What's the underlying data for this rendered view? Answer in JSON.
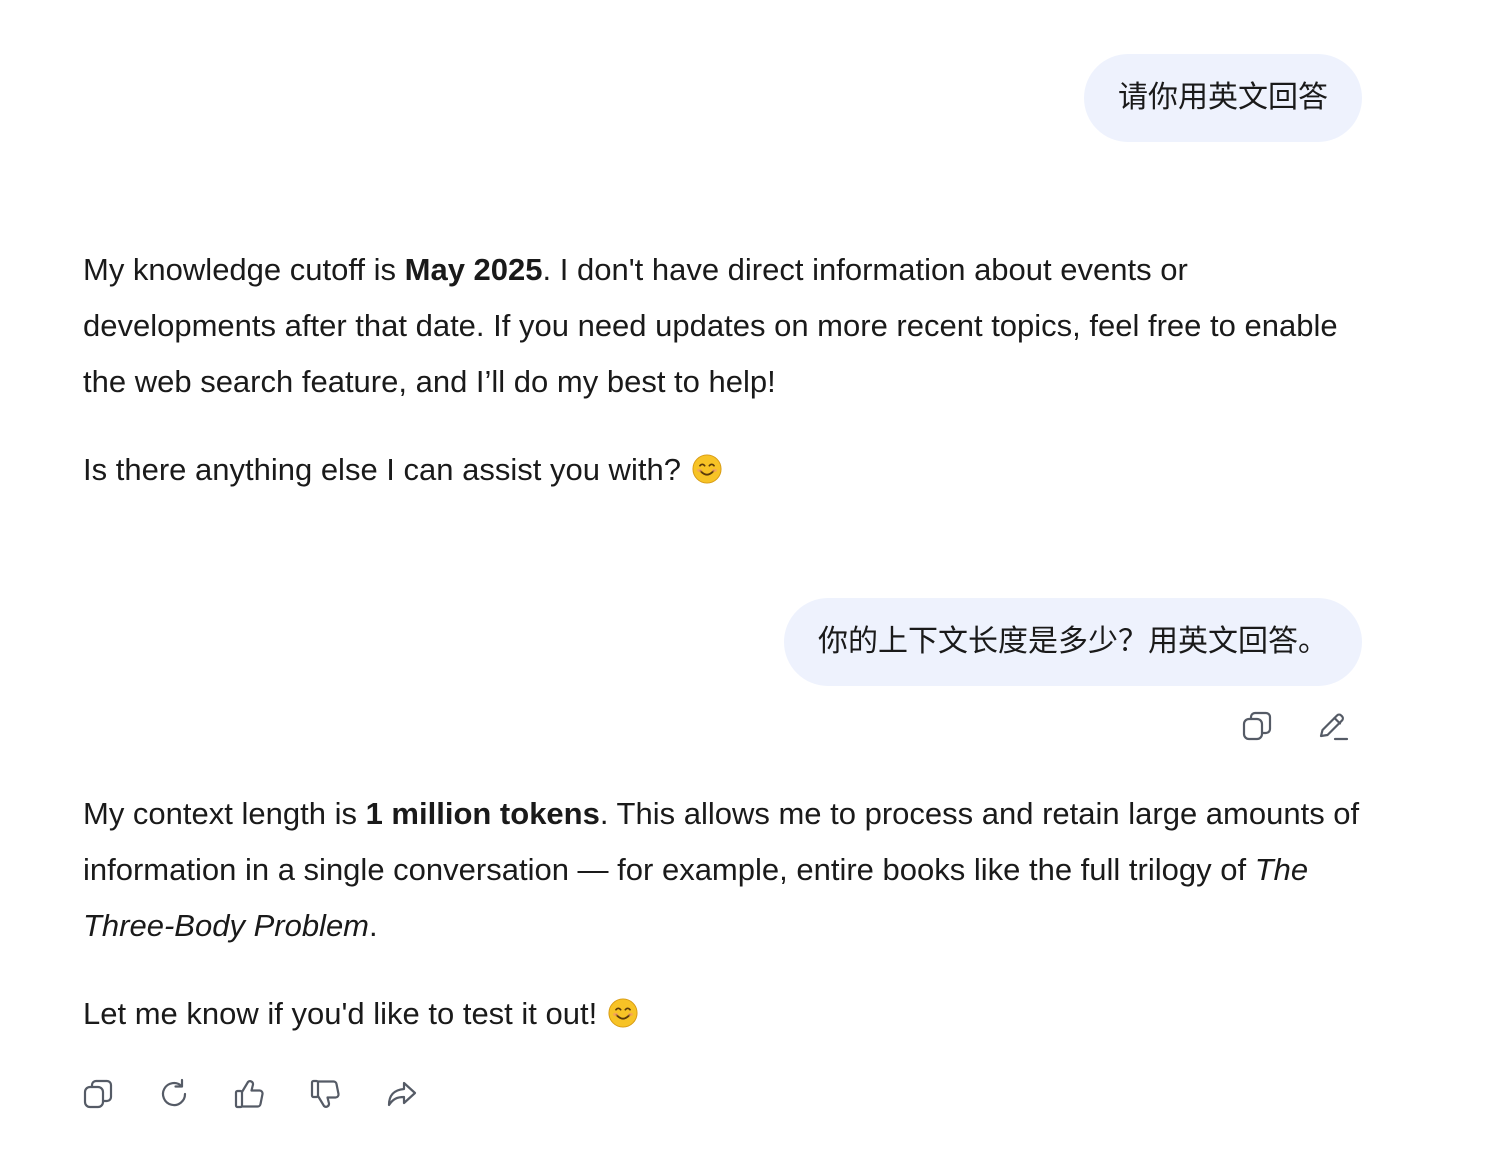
{
  "conversation": {
    "user_messages": [
      {
        "text": "请你用英文回答"
      },
      {
        "text": "你的上下文长度是多少？用英文回答。"
      }
    ],
    "answers": [
      {
        "p1_before": "My knowledge cutoff is ",
        "p1_bold": "May 2025",
        "p1_after": ". I don't have direct information about events or developments after that date. If you need updates on more recent topics, feel free to enable the web search feature, and I’ll do my best to help!",
        "p2": "Is there anything else I can assist you with? ",
        "p2_emoji": "smiling-face-emoji"
      },
      {
        "p1_before": "My context length is ",
        "p1_bold": "1 million tokens",
        "p1_mid": ". This allows me to process and retain large amounts of information in a single conversation — for example, entire books like the full trilogy of ",
        "p1_italic": "The Three-Body Problem",
        "p1_after": ".",
        "p2": "Let me know if you'd like to test it out! ",
        "p2_emoji": "smiling-face-emoji"
      }
    ]
  },
  "user_actions": [
    "copy-icon",
    "edit-icon"
  ],
  "assistant_actions": [
    "copy-icon",
    "regenerate-icon",
    "thumbs-up-icon",
    "thumbs-down-icon",
    "share-icon"
  ],
  "colors": {
    "user_bubble": "#eef2fd",
    "text": "#1a1a1a",
    "icon": "#555b66",
    "emoji_face": "#f7c326"
  }
}
